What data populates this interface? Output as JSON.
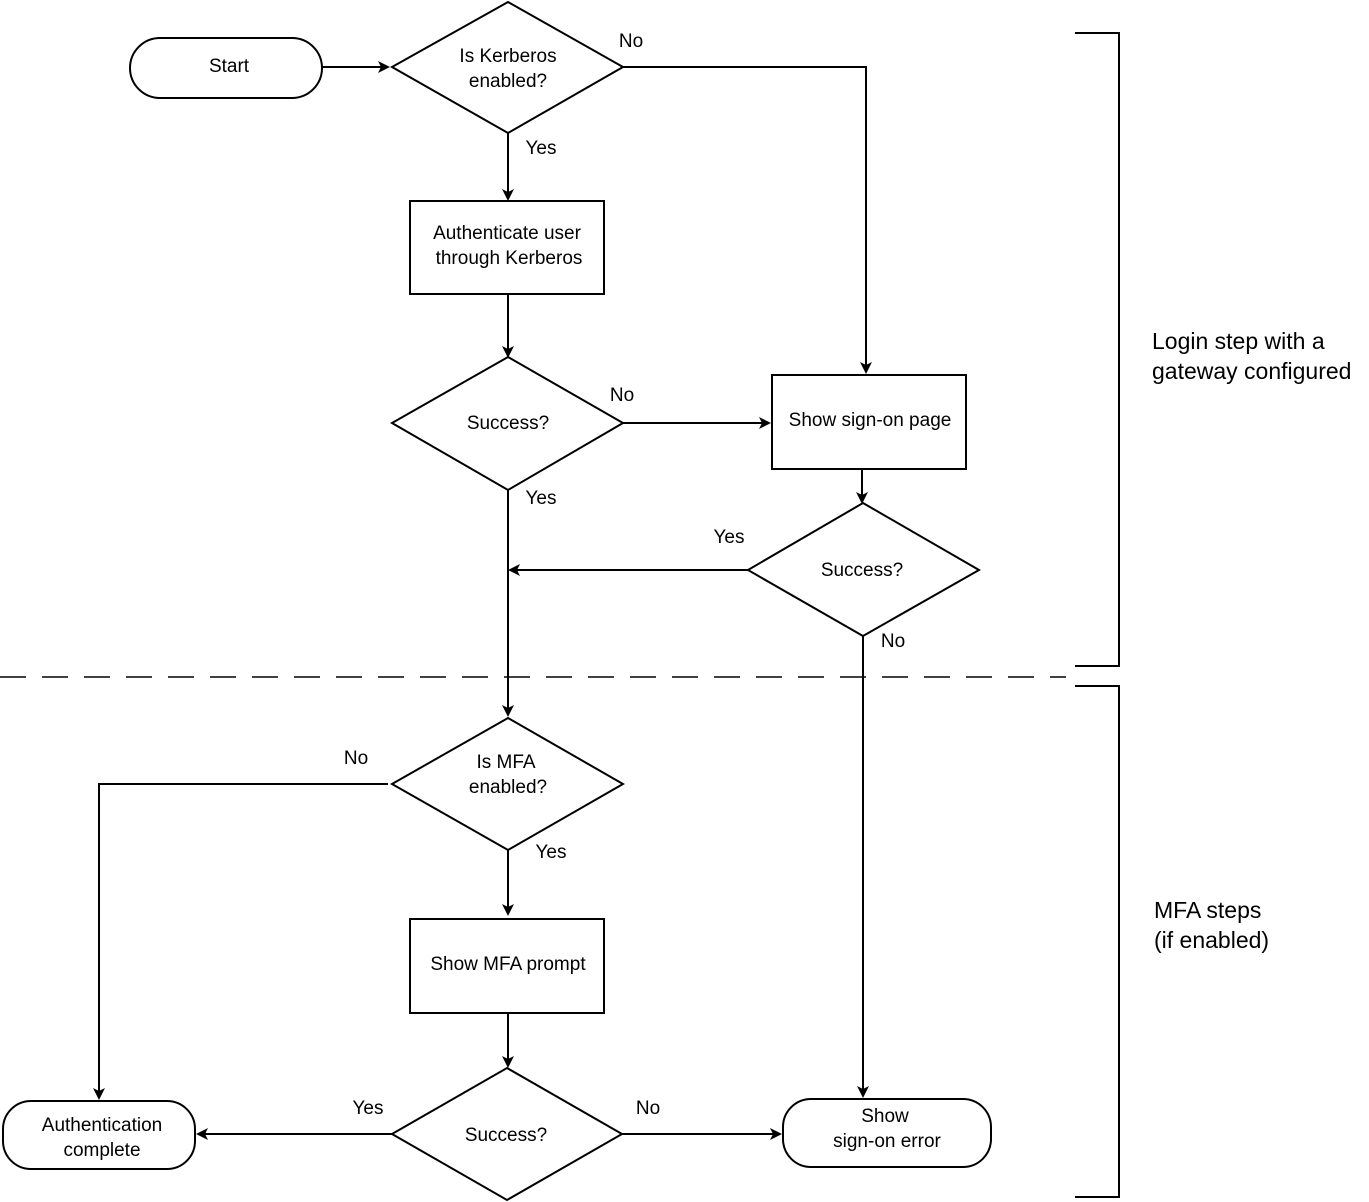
{
  "nodes": {
    "start": {
      "lines": [
        "Start"
      ]
    },
    "kerberos_enabled": {
      "lines": [
        "Is Kerberos",
        "enabled?"
      ]
    },
    "authenticate_kerberos": {
      "lines": [
        "Authenticate user",
        "through Kerberos"
      ]
    },
    "kerberos_success": {
      "lines": [
        "Success?"
      ]
    },
    "show_signon_page": {
      "lines": [
        "Show sign-on page"
      ]
    },
    "signon_success": {
      "lines": [
        "Success?"
      ]
    },
    "mfa_enabled": {
      "lines": [
        "Is MFA",
        "enabled?"
      ]
    },
    "show_mfa_prompt": {
      "lines": [
        "Show MFA prompt"
      ]
    },
    "mfa_success": {
      "lines": [
        "Success?"
      ]
    },
    "auth_complete": {
      "lines": [
        "Authentication",
        "complete"
      ]
    },
    "signon_error": {
      "lines": [
        "Show",
        "sign-on error"
      ]
    }
  },
  "edge_labels": {
    "kerberos_no": "No",
    "kerberos_yes": "Yes",
    "kerberos_success_no": "No",
    "kerberos_success_yes": "Yes",
    "signon_success_yes": "Yes",
    "signon_success_no": "No",
    "mfa_no": "No",
    "mfa_yes": "Yes",
    "mfa_success_yes": "Yes",
    "mfa_success_no": "No"
  },
  "sections": {
    "login": {
      "lines": [
        "Login step with a",
        "gateway configured"
      ]
    },
    "mfa": {
      "lines": [
        "MFA steps",
        "(if enabled)"
      ]
    }
  }
}
